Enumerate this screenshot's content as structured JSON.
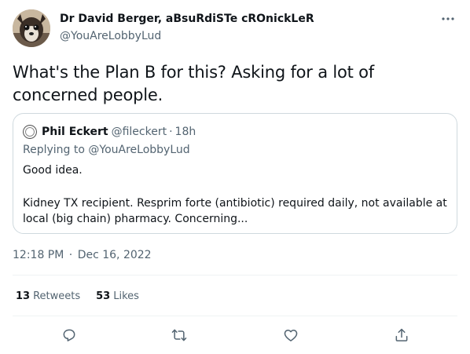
{
  "author": {
    "name": "Dr David Berger, aBsuRdiSTe cROnickLeR",
    "handle": "@YouAreLobbyLud"
  },
  "tweet": {
    "text": "What's the Plan B for this? Asking for a lot of concerned people."
  },
  "quote": {
    "name": "Phil Eckert",
    "handle": "@fileckert",
    "separator": "·",
    "time": "18h",
    "reply_prefix": "Replying to",
    "reply_handle": "@YouAreLobbyLud",
    "line1": "Good idea.",
    "line2": "Kidney TX recipient. Resprim forte (antibiotic) required daily, not available at local (big chain) pharmacy. Concerning..."
  },
  "meta": {
    "time": "12:18 PM",
    "separator": "·",
    "date": "Dec 16, 2022"
  },
  "stats": {
    "retweets_count": "13",
    "retweets_label": "Retweets",
    "likes_count": "53",
    "likes_label": "Likes"
  },
  "icons": {
    "more": "more-horizontal-icon",
    "reply": "reply-icon",
    "retweet": "retweet-icon",
    "like": "heart-icon",
    "share": "share-icon"
  },
  "colors": {
    "text_primary": "#0f1419",
    "text_secondary": "#536471",
    "border": "#cfd9de",
    "divider": "#eff3f4"
  }
}
